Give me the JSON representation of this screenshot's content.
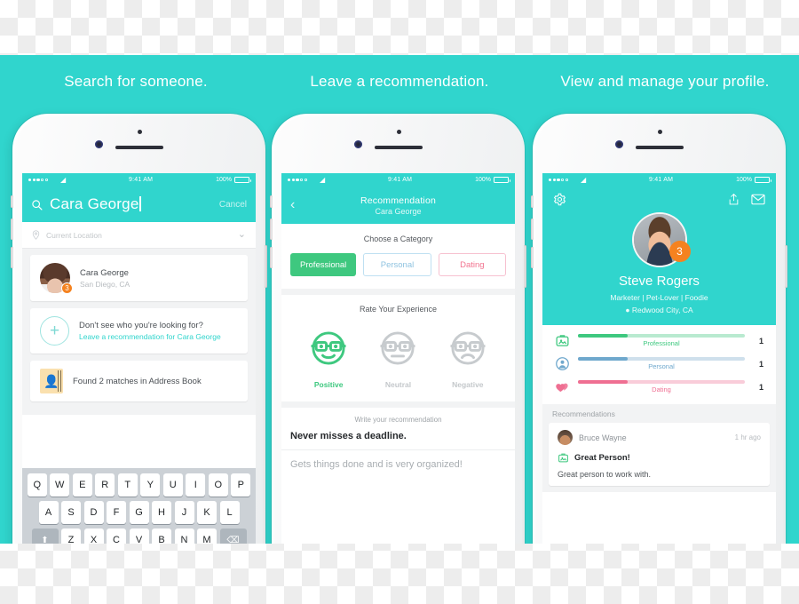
{
  "headlines": {
    "first": "Search for someone.",
    "second": "Leave a recommendation.",
    "third": "View and manage your profile."
  },
  "colors": {
    "teal": "#30d5cd",
    "green": "#3ec87f",
    "blue": "#8fc3e0",
    "pink": "#f2738f",
    "orange": "#f5821f"
  },
  "status_bar": {
    "time": "9:41 AM",
    "battery": "100%",
    "wifi_icon": "wifi-icon"
  },
  "phone1": {
    "search": {
      "icon": "search-icon",
      "value": "Cara George",
      "placeholder": "Search",
      "cancel": "Cancel"
    },
    "location": {
      "icon": "map-pin-icon",
      "placeholder": "Current Location",
      "chevron": "chevron-down-icon"
    },
    "results": [
      {
        "name": "Cara George",
        "sub": "San Diego, CA",
        "badge": "3"
      }
    ],
    "add_card": {
      "question": "Don't see who you're looking for?",
      "link": "Leave a recommendation for Cara George",
      "icon": "plus-circle-icon"
    },
    "address_book": {
      "icon": "address-book-icon",
      "text": "Found 2 matches in Address Book"
    },
    "keyboard": {
      "row1": [
        "Q",
        "W",
        "E",
        "R",
        "T",
        "Y",
        "U",
        "I",
        "O",
        "P"
      ],
      "row2": [
        "A",
        "S",
        "D",
        "F",
        "G",
        "H",
        "J",
        "K",
        "L"
      ],
      "row3": [
        "Z",
        "X",
        "C",
        "V",
        "B",
        "N",
        "M"
      ],
      "shift": "shift-icon",
      "backspace": "backspace-icon"
    }
  },
  "phone2": {
    "nav": {
      "back": "back-chevron-icon",
      "title": "Recommendation",
      "subtitle": "Cara George"
    },
    "category": {
      "title": "Choose a Category",
      "options": [
        {
          "label": "Professional",
          "selected": true
        },
        {
          "label": "Personal",
          "selected": false
        },
        {
          "label": "Dating",
          "selected": false
        }
      ]
    },
    "rating": {
      "title": "Rate Your Experience",
      "options": [
        {
          "label": "Positive",
          "icon": "smiley-positive-icon",
          "selected": true
        },
        {
          "label": "Neutral",
          "icon": "smiley-neutral-icon",
          "selected": false
        },
        {
          "label": "Negative",
          "icon": "smiley-negative-icon",
          "selected": false
        }
      ]
    },
    "recommendation": {
      "title": "Write your recommendation",
      "headline": "Never misses a deadline.",
      "body": "Gets things done and is very organized!"
    }
  },
  "phone3": {
    "toolbar": {
      "settings": "gear-icon",
      "share": "share-icon",
      "mail": "envelope-icon"
    },
    "profile": {
      "name": "Steve Rogers",
      "tags": "Marketer | Pet-Lover | Foodie",
      "location": "Redwood City, CA",
      "location_icon": "map-pin-icon",
      "badge": "3",
      "avatar": "avatar"
    },
    "stats": [
      {
        "label": "Professional",
        "count": "1",
        "icon": "briefcase-badge-icon",
        "fill_pct": 30,
        "color": "#3ec87f",
        "track": "#b9ead0"
      },
      {
        "label": "Personal",
        "count": "1",
        "icon": "person-circle-icon",
        "fill_pct": 30,
        "color": "#6fa8cd",
        "track": "#cfe0ec"
      },
      {
        "label": "Dating",
        "count": "1",
        "icon": "hearts-icon",
        "fill_pct": 30,
        "color": "#ef6f92",
        "track": "#f9ccd9"
      }
    ],
    "recommendations": {
      "header": "Recommendations",
      "items": [
        {
          "author": "Bruce Wayne",
          "time": "1 hr ago",
          "category_icon": "briefcase-badge-icon",
          "title": "Great Person!",
          "text": "Great person to work with."
        }
      ]
    }
  }
}
